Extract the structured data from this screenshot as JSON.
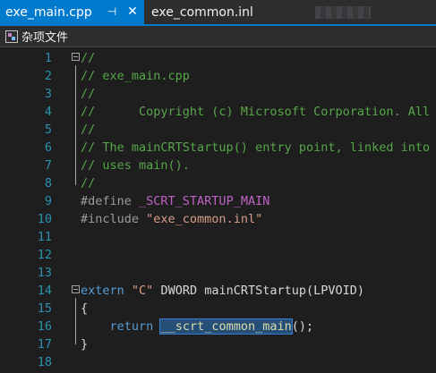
{
  "tabs": [
    {
      "label": "exe_main.cpp",
      "active": true,
      "pin_icon": "pin-icon",
      "close_icon": "close-icon"
    },
    {
      "label": "exe_common.inl",
      "active": false
    }
  ],
  "navbar": {
    "scope_label": "杂项文件",
    "icon": "misc-files-icon"
  },
  "colors": {
    "accent": "#007acc",
    "background": "#1e1e1e",
    "comment": "#57a64a",
    "keyword": "#569cd6",
    "string": "#d69d85",
    "line_number": "#2b91af",
    "macro": "#bd63c5"
  },
  "editor": {
    "lines": [
      {
        "n": "1",
        "parts": [
          {
            "c": "cm",
            "t": "//"
          }
        ]
      },
      {
        "n": "2",
        "parts": [
          {
            "c": "cm",
            "t": "// exe_main.cpp"
          }
        ]
      },
      {
        "n": "3",
        "parts": [
          {
            "c": "cm",
            "t": "//"
          }
        ]
      },
      {
        "n": "4",
        "parts": [
          {
            "c": "cm",
            "t": "//      Copyright (c) Microsoft Corporation. All"
          }
        ]
      },
      {
        "n": "5",
        "parts": [
          {
            "c": "cm",
            "t": "//"
          }
        ]
      },
      {
        "n": "6",
        "parts": [
          {
            "c": "cm",
            "t": "// The mainCRTStartup() entry point, linked into"
          }
        ]
      },
      {
        "n": "7",
        "parts": [
          {
            "c": "cm",
            "t": "// uses main()."
          }
        ]
      },
      {
        "n": "8",
        "parts": [
          {
            "c": "cm",
            "t": "//"
          }
        ]
      },
      {
        "n": "9",
        "parts": [
          {
            "c": "pp",
            "t": "#define "
          },
          {
            "c": "mac",
            "t": "_SCRT_STARTUP_MAIN"
          }
        ]
      },
      {
        "n": "10",
        "parts": [
          {
            "c": "pp",
            "t": "#include "
          },
          {
            "c": "str",
            "t": "\"exe_common.inl\""
          }
        ]
      },
      {
        "n": "11",
        "parts": []
      },
      {
        "n": "12",
        "parts": []
      },
      {
        "n": "13",
        "parts": []
      },
      {
        "n": "14",
        "parts": [
          {
            "c": "kw",
            "t": "extern"
          },
          {
            "c": "ty",
            "t": " "
          },
          {
            "c": "str",
            "t": "\"C\""
          },
          {
            "c": "ty",
            "t": " DWORD mainCRTStartup(LPVOID)"
          }
        ]
      },
      {
        "n": "15",
        "parts": [
          {
            "c": "ty",
            "t": "{"
          }
        ]
      },
      {
        "n": "16",
        "parts": [
          {
            "c": "ty",
            "t": "    "
          },
          {
            "c": "kw",
            "t": "return"
          },
          {
            "c": "ty",
            "t": " "
          },
          {
            "c": "fn sel",
            "t": "__scrt_common_main"
          },
          {
            "c": "ty",
            "t": "();"
          }
        ]
      },
      {
        "n": "17",
        "parts": [
          {
            "c": "ty",
            "t": "}"
          }
        ]
      },
      {
        "n": "18",
        "parts": []
      }
    ]
  }
}
